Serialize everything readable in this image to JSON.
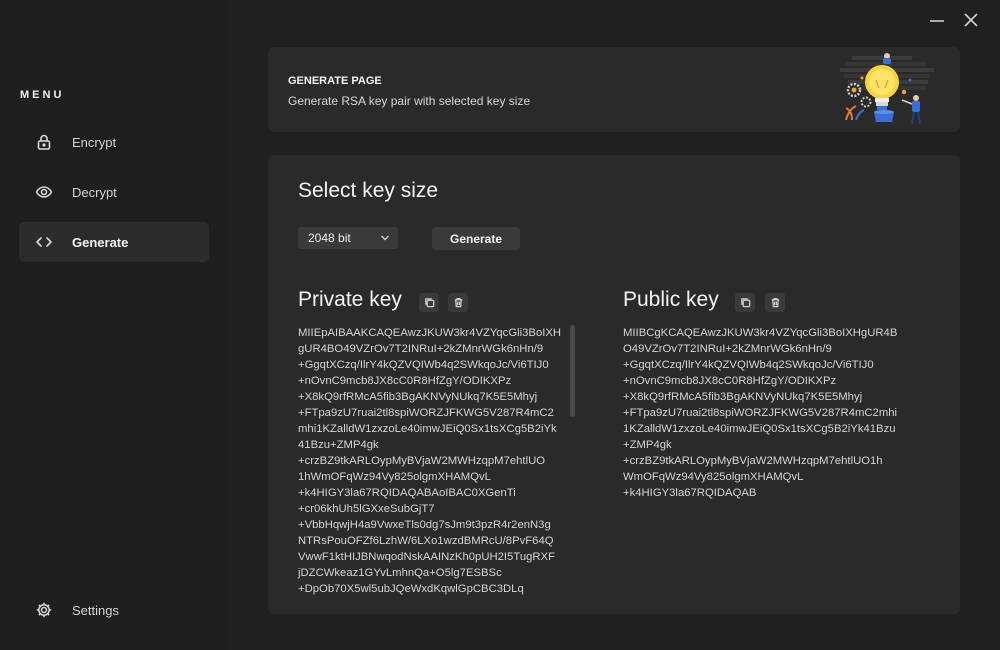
{
  "sidebar": {
    "menu_title": "MENU",
    "items": [
      {
        "label": "Encrypt",
        "icon": "lock-icon"
      },
      {
        "label": "Decrypt",
        "icon": "eye-icon"
      },
      {
        "label": "Generate",
        "icon": "code-icon",
        "active": true
      }
    ],
    "settings_label": "Settings"
  },
  "header": {
    "title": "GENERATE PAGE",
    "subtitle": "Generate RSA key pair with selected key size"
  },
  "main": {
    "section_title": "Select key size",
    "key_size": {
      "selected": "2048 bit"
    },
    "generate_label": "Generate",
    "private_key": {
      "title": "Private key",
      "lines": [
        "MIIEpAIBAAKCAQEAwzJKUW3kr4VZYqcGli3BoIXH",
        "gUR4BO49VZrOv7T2INRuI+2kZMnrWGk6nHn/9",
        "+GgqtXCzq/IlrY4kQZVQIWb4q2SWkqoJc/Vi6TIJ0",
        "+nOvnC9mcb8JX8cC0R8HfZgY/ODIKXPz",
        "+X8kQ9rfRMcA5fib3BgAKNVyNUkq7K5E5Mhyj",
        "+FTpa9zU7ruai2tl8spiWORZJFKWG5V287R4mC2",
        "mhi1KZalldW1zxzoLe40imwJEiQ0Sx1tsXCg5B2iYk",
        "41Bzu+ZMP4gk",
        "+crzBZ9tkARLOypMyBVjaW2MWHzqpM7ehtlUO",
        "1hWmOFqWz94Vy825olgmXHAMQvL",
        "+k4HIGY3la67RQIDAQABAoIBAC0XGenTi",
        "+cr06khUh5lGXxeSubGjT7",
        "+VbbHqwjH4a9VwxeTls0dg7sJm9t3pzR4r2enN3g",
        "NTRsPouOFZf6LzhW/6LXo1wzdBMRcU/8PvF64Q",
        "VwwF1ktHIJBNwqodNskAAINzKh0pUH2I5TugRXF",
        "jDZCWkeaz1GYvLmhnQa+O5lg7ESBSc",
        "+DpOb70X5wl5ubJQeWxdKqwlGpCBC3DLq"
      ]
    },
    "public_key": {
      "title": "Public key",
      "lines": [
        "MIIBCgKCAQEAwzJKUW3kr4VZYqcGli3BoIXHgUR4B",
        "O49VZrOv7T2INRuI+2kZMnrWGk6nHn/9",
        "+GgqtXCzq/IlrY4kQZVQIWb4q2SWkqoJc/Vi6TIJ0",
        "+nOvnC9mcb8JX8cC0R8HfZgY/ODIKXPz",
        "+X8kQ9rfRMcA5fib3BgAKNVyNUkq7K5E5Mhyj",
        "+FTpa9zU7ruai2tl8spiWORZJFKWG5V287R4mC2mhi",
        "1KZalldW1zxzoLe40imwJEiQ0Sx1tsXCg5B2iYk41Bzu",
        "+ZMP4gk",
        "+crzBZ9tkARLOypMyBVjaW2MWHzqpM7ehtlUO1h",
        "WmOFqWz94Vy825olgmXHAMQvL",
        "+k4HIGY3la67RQIDAQAB"
      ]
    }
  },
  "colors": {
    "sidebar_bg": "#1f1f1f",
    "main_bg": "#202020",
    "card_bg": "#2a2a2a",
    "active_item_bg": "#2c2c2c",
    "button_bg": "#3a3a3a"
  }
}
